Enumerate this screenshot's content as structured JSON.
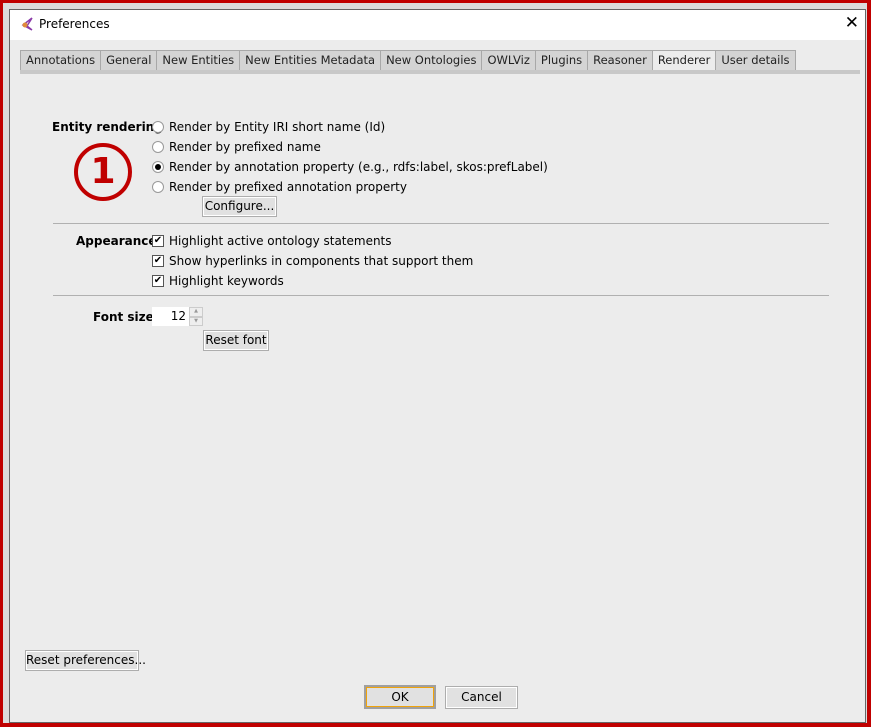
{
  "window": {
    "title": "Preferences",
    "close_icon": "close-icon"
  },
  "tabs": [
    {
      "label": "Annotations"
    },
    {
      "label": "General"
    },
    {
      "label": "New Entities"
    },
    {
      "label": "New Entities Metadata"
    },
    {
      "label": "New Ontologies"
    },
    {
      "label": "OWLViz"
    },
    {
      "label": "Plugins"
    },
    {
      "label": "Reasoner"
    },
    {
      "label": "Renderer",
      "active": true
    },
    {
      "label": "User details"
    }
  ],
  "renderer": {
    "entity_rendering": {
      "label": "Entity rendering",
      "options": [
        {
          "label": "Render by Entity IRI short name (Id)",
          "selected": false
        },
        {
          "label": "Render by prefixed name",
          "selected": false
        },
        {
          "label": "Render by annotation property (e.g., rdfs:label, skos:prefLabel)",
          "selected": true
        },
        {
          "label": "Render by prefixed annotation property",
          "selected": false
        }
      ],
      "configure_label": "Configure..."
    },
    "annotation_marker": "1",
    "appearance": {
      "label": "Appearance",
      "options": [
        {
          "label": "Highlight active ontology statements",
          "checked": true
        },
        {
          "label": "Show hyperlinks in components that support them",
          "checked": true
        },
        {
          "label": "Highlight keywords",
          "checked": true
        }
      ]
    },
    "font_size": {
      "label": "Font size",
      "value": "12",
      "reset_label": "Reset font"
    }
  },
  "footer": {
    "reset_preferences": "Reset preferences...",
    "ok": "OK",
    "cancel": "Cancel"
  },
  "colors": {
    "annotation": "#c00000",
    "ok_focus": "#f0a30a"
  }
}
